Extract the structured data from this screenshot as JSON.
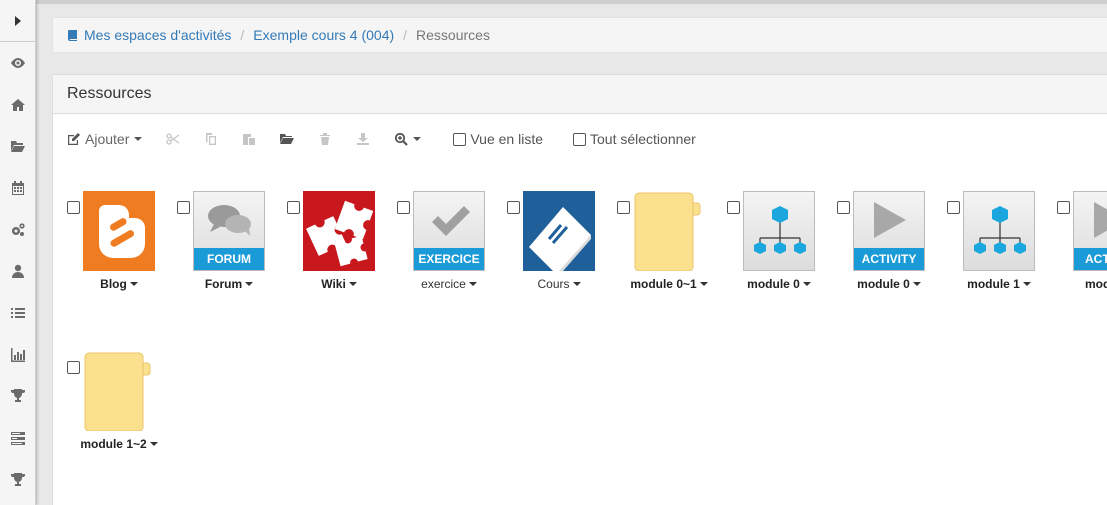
{
  "sidebar": {
    "toggle_icon": "chevron-right-icon",
    "items": [
      {
        "icon": "eye-icon"
      },
      {
        "icon": "home-icon"
      },
      {
        "icon": "folder-open-icon"
      },
      {
        "icon": "calendar-icon"
      },
      {
        "icon": "cogs-icon"
      },
      {
        "icon": "user-icon"
      },
      {
        "icon": "list-icon"
      },
      {
        "icon": "bar-chart-icon"
      },
      {
        "icon": "trophy-icon"
      },
      {
        "icon": "tasks-icon"
      },
      {
        "icon": "trophy-icon"
      }
    ]
  },
  "breadcrumb": {
    "items": [
      "Mes espaces d'activités",
      "Exemple cours 4 (004)"
    ],
    "current": "Ressources"
  },
  "panel": {
    "title": "Ressources"
  },
  "toolbar": {
    "add_label": "Ajouter",
    "list_view_label": "Vue en liste",
    "select_all_label": "Tout sélectionner"
  },
  "resources": [
    {
      "label": "Blog",
      "type": "blog"
    },
    {
      "label": "Forum",
      "type": "forum",
      "band": "FORUM"
    },
    {
      "label": "Wiki",
      "type": "wiki"
    },
    {
      "label": "exercice",
      "type": "exercice",
      "band": "EXERCICE"
    },
    {
      "label": "Cours",
      "type": "cours"
    },
    {
      "label": "module 0~1",
      "type": "folder"
    },
    {
      "label": "module 0",
      "type": "module"
    },
    {
      "label": "module 0",
      "type": "activity",
      "band": "ACTIVITY"
    },
    {
      "label": "module 1",
      "type": "module"
    },
    {
      "label": "modu",
      "type": "activity",
      "band": "ACTI"
    },
    {
      "label": "module 1~2",
      "type": "folder"
    }
  ],
  "colors": {
    "link": "#337ab7",
    "blog": "#f07c22",
    "wiki": "#c8181e",
    "cours": "#1f5f9a",
    "band": "#1a9ad6",
    "module": "#1ba7dd",
    "folder": "#fbe08e"
  }
}
